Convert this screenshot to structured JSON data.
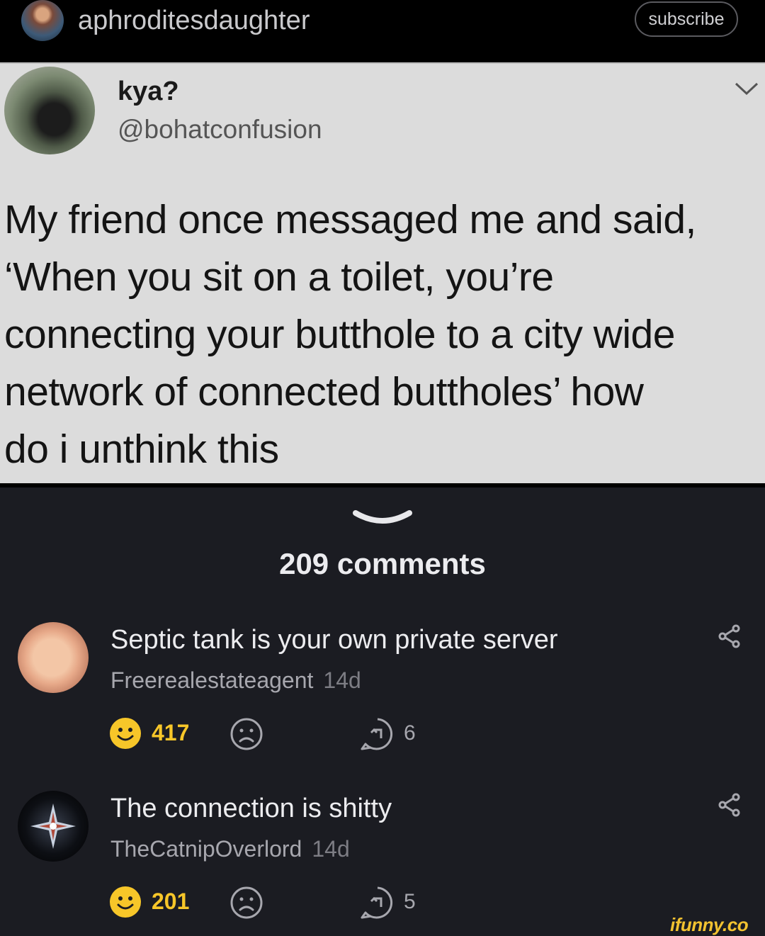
{
  "header": {
    "username": "aphroditesdaughter",
    "subscribe_label": "subscribe"
  },
  "tweet": {
    "display_name": "kya?",
    "handle": "@bohatconfusion",
    "lines": [
      "My friend once messaged me and said,",
      "‘When you sit on a toilet, you’re",
      "connecting your butthole to a city wide",
      "network of connected buttholes’ how",
      "do i unthink this"
    ]
  },
  "comments_header": {
    "count_label": "209 comments"
  },
  "comments": [
    {
      "text": "Septic tank is your own private server",
      "author": "Freerealestateagent",
      "time": "14d",
      "smiles": "417",
      "replies": "6"
    },
    {
      "text": "The connection is shitty",
      "author": "TheCatnipOverlord",
      "time": "14d",
      "smiles": "201",
      "replies": "5"
    }
  ],
  "watermark": "ifunny.co",
  "colors": {
    "background": "#1b1c22",
    "accent_smile": "#f7c629",
    "tweet_bg": "#dcdcdc"
  }
}
